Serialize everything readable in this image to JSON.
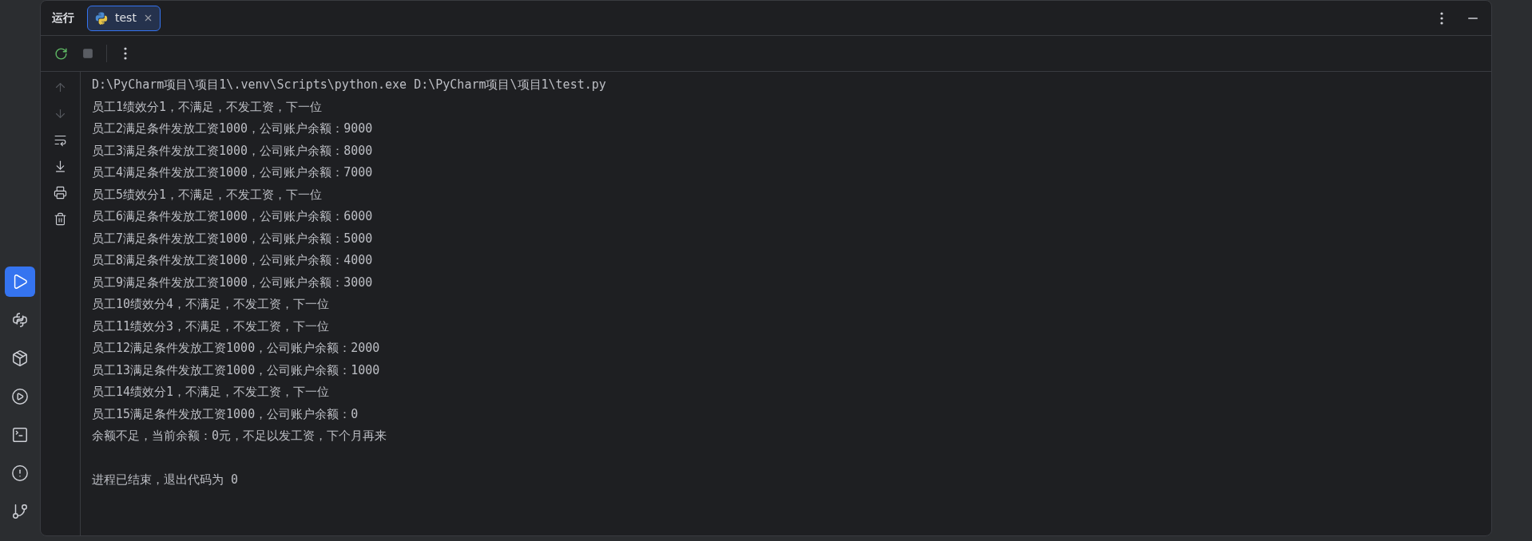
{
  "tool_windows": [
    {
      "kind": "run",
      "selected": true
    },
    {
      "kind": "python",
      "selected": false
    },
    {
      "kind": "packages",
      "selected": false
    },
    {
      "kind": "services",
      "selected": false
    },
    {
      "kind": "terminal",
      "selected": false
    },
    {
      "kind": "problems",
      "selected": false
    },
    {
      "kind": "git",
      "selected": false
    }
  ],
  "header": {
    "label": "运行"
  },
  "tabs": [
    {
      "label": "test",
      "selected": true
    }
  ],
  "toolbar": [
    {
      "kind": "rerun",
      "disabled": false
    },
    {
      "kind": "stop",
      "disabled": true
    },
    {
      "kind": "more",
      "disabled": false
    }
  ],
  "gutter_actions": [
    {
      "kind": "up",
      "disabled": true
    },
    {
      "kind": "down",
      "disabled": true
    },
    {
      "kind": "wrap",
      "disabled": false
    },
    {
      "kind": "scroll_end",
      "disabled": false
    },
    {
      "kind": "print",
      "disabled": false
    },
    {
      "kind": "clear",
      "disabled": false
    }
  ],
  "console": {
    "command": "D:\\PyCharm项目\\项目1\\.venv\\Scripts\\python.exe D:\\PyCharm项目\\项目1\\test.py",
    "output": [
      "员工1绩效分1，不满足，不发工资，下一位",
      "员工2满足条件发放工资1000，公司账户余额：9000",
      "员工3满足条件发放工资1000，公司账户余额：8000",
      "员工4满足条件发放工资1000，公司账户余额：7000",
      "员工5绩效分1，不满足，不发工资，下一位",
      "员工6满足条件发放工资1000，公司账户余额：6000",
      "员工7满足条件发放工资1000，公司账户余额：5000",
      "员工8满足条件发放工资1000，公司账户余额：4000",
      "员工9满足条件发放工资1000，公司账户余额：3000",
      "员工10绩效分4，不满足，不发工资，下一位",
      "员工11绩效分3，不满足，不发工资，下一位",
      "员工12满足条件发放工资1000，公司账户余额：2000",
      "员工13满足条件发放工资1000，公司账户余额：1000",
      "员工14绩效分1，不满足，不发工资，下一位",
      "员工15满足条件发放工资1000，公司账户余额：0",
      "余额不足，当前余额：0元，不足以发工资，下个月再来"
    ],
    "exit_message": "进程已结束，退出代码为 0"
  }
}
